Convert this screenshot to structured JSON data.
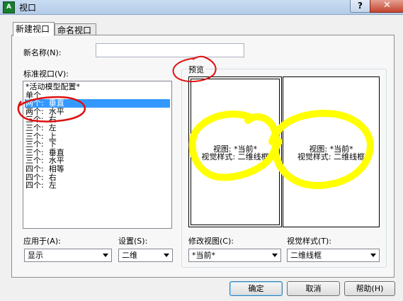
{
  "window": {
    "title": "视口",
    "icon_label": "A",
    "help_label": "?",
    "close_label": "✕"
  },
  "tabs": [
    {
      "label": "新建视口"
    },
    {
      "label": "命名视口"
    }
  ],
  "new_name": {
    "label": "新名称(N):",
    "value": ""
  },
  "standard_viewports": {
    "label": "标准视口(V):",
    "items": [
      "*活动模型配置*",
      "单个",
      "两个:  垂直",
      "两个:  水平",
      "三个:  右",
      "三个:  左",
      "三个:  上",
      "三个:  下",
      "三个:  垂直",
      "三个:  水平",
      "四个:  相等",
      "四个:  右",
      "四个:  左"
    ],
    "selected_index": 2
  },
  "preview": {
    "label": "预览",
    "panes": [
      {
        "line1": "视图: *当前*",
        "line2": "视觉样式: 二维线框"
      },
      {
        "line1": "视图: *当前*",
        "line2": "视觉样式: 二维线框"
      }
    ]
  },
  "apply_to": {
    "label": "应用于(A):",
    "value": "显示"
  },
  "setup": {
    "label": "设置(S):",
    "value": "二维"
  },
  "change_view": {
    "label": "修改视图(C):",
    "value": "*当前*"
  },
  "visual_style": {
    "label": "视觉样式(T):",
    "value": "二维线框"
  },
  "buttons": {
    "ok": "确定",
    "cancel": "取消",
    "help": "帮助(H)"
  },
  "colors": {
    "selection": "#3399ff",
    "red_annotation": "#e01010",
    "yellow_annotation": "#ffff00"
  }
}
